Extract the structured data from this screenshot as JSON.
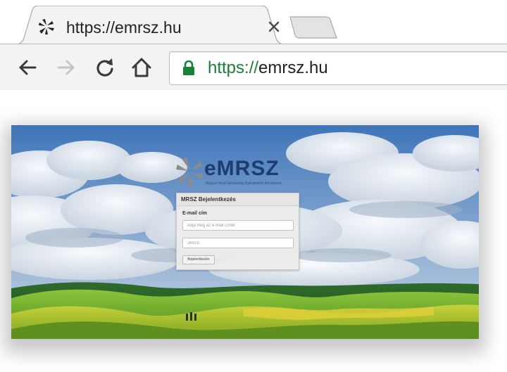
{
  "browser": {
    "tab": {
      "title": "https://emrsz.hu",
      "favicon": "emrsz-logo-icon",
      "close_icon": "close-icon"
    },
    "new_tab_icon": "new-tab-icon",
    "nav": {
      "back_icon": "arrow-left-icon",
      "forward_icon": "arrow-right-icon",
      "reload_icon": "reload-icon",
      "home_icon": "home-icon"
    },
    "address": {
      "lock_icon": "lock-icon",
      "scheme": "https://",
      "host": "emrsz.hu"
    }
  },
  "page": {
    "brand": {
      "name": "eMRSZ",
      "subtitle": "Magyar Rejtő Szövetség Nyilvántartó Rendszere"
    },
    "login": {
      "title": "MRSZ Bejelentkezés",
      "email_label": "E-mail cím",
      "email_placeholder": "Adja meg az e-mail címét",
      "password_placeholder": "Jelszó",
      "submit_label": "Bejelentkezés"
    },
    "background": "sky-and-green-hills-image"
  },
  "colors": {
    "secure_green": "#188038",
    "brand_navy": "#1e3c6d",
    "toolbar_bg": "#f3f3f3"
  }
}
